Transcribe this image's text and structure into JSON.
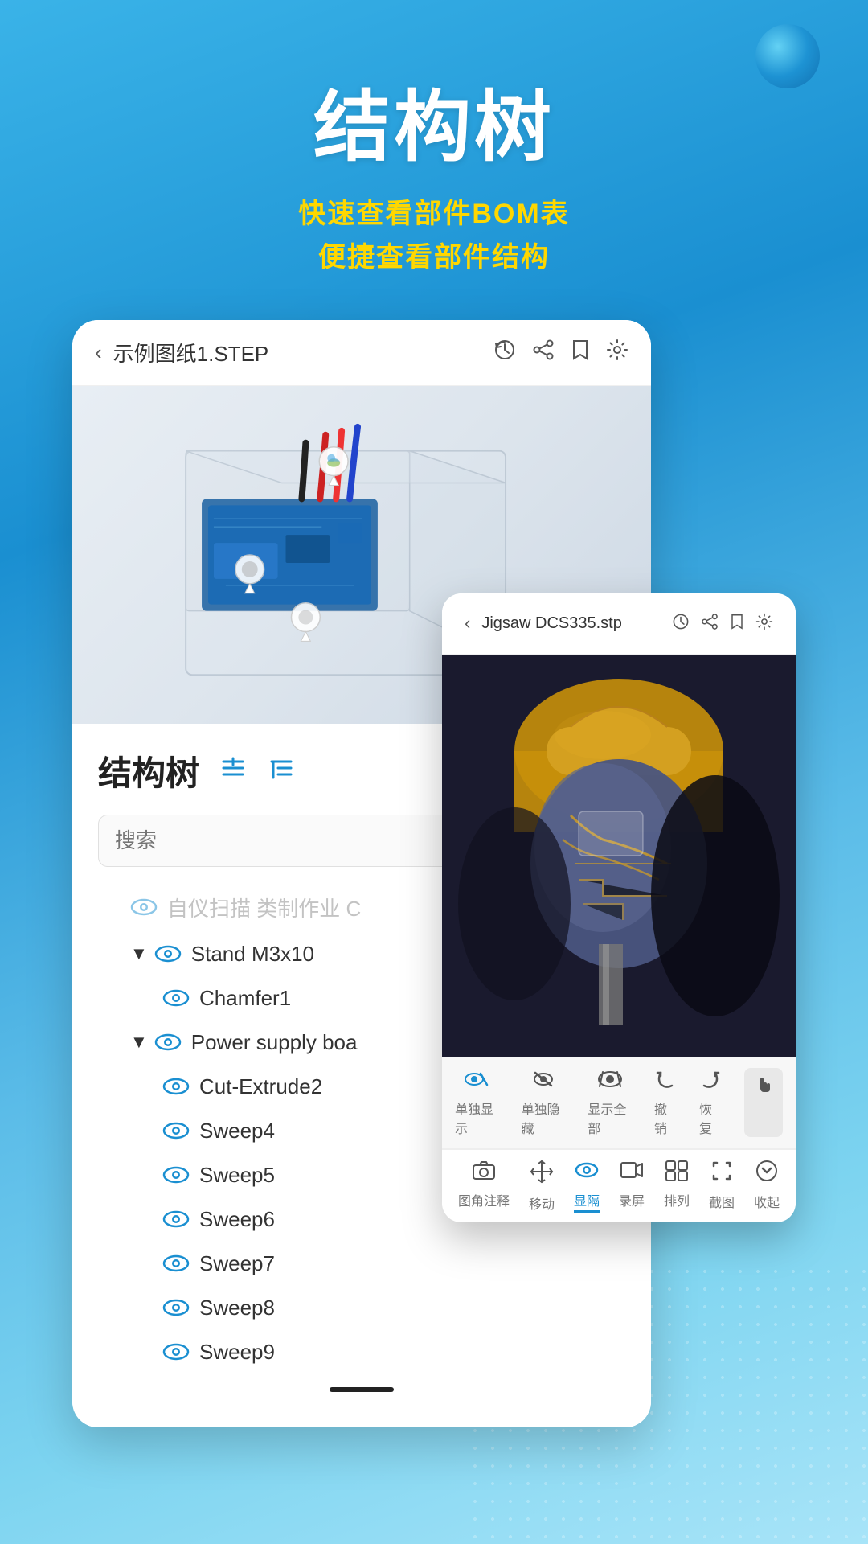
{
  "hero": {
    "title": "结构树",
    "subtitle_line1": "快速查看部件BOM表",
    "subtitle_line2": "便捷查看部件结构"
  },
  "card_primary": {
    "header": {
      "back_label": "‹",
      "file_title": "示例图纸1.STEP",
      "icon_history": "⏱",
      "icon_share": "⬆",
      "icon_bookmark": "🔖",
      "icon_settings": "⚙"
    },
    "panel": {
      "title": "结构树",
      "search_placeholder": "搜索",
      "tree_items": [
        {
          "indent": 1,
          "has_arrow": false,
          "faded": true,
          "label": "自仪扫描 类制作业 C"
        },
        {
          "indent": 1,
          "has_arrow": true,
          "faded": false,
          "label": "Stand M3x10"
        },
        {
          "indent": 2,
          "has_arrow": false,
          "faded": false,
          "label": "Chamfer1"
        },
        {
          "indent": 1,
          "has_arrow": true,
          "faded": false,
          "label": "Power supply  boa"
        },
        {
          "indent": 2,
          "has_arrow": false,
          "faded": false,
          "label": "Cut-Extrude2"
        },
        {
          "indent": 2,
          "has_arrow": false,
          "faded": false,
          "label": "Sweep4"
        },
        {
          "indent": 2,
          "has_arrow": false,
          "faded": false,
          "label": "Sweep5"
        },
        {
          "indent": 2,
          "has_arrow": false,
          "faded": false,
          "label": "Sweep6"
        },
        {
          "indent": 2,
          "has_arrow": false,
          "faded": false,
          "label": "Sweep7"
        },
        {
          "indent": 2,
          "has_arrow": false,
          "faded": false,
          "label": "Sweep8"
        },
        {
          "indent": 2,
          "has_arrow": false,
          "faded": false,
          "label": "Sweep9"
        }
      ]
    }
  },
  "card_secondary": {
    "header": {
      "back_label": "‹",
      "file_title": "Jigsaw DCS335.stp",
      "icon_history": "⏱",
      "icon_share": "⬆",
      "icon_bookmark": "🔖",
      "icon_settings": "⚙"
    },
    "toolbar_top": [
      {
        "icon": "✦",
        "label": "单独显示"
      },
      {
        "icon": "✦",
        "label": "单独隐藏"
      },
      {
        "icon": "✦",
        "label": "显示全部"
      },
      {
        "icon": "↺",
        "label": "撤销"
      },
      {
        "icon": "↻",
        "label": "恢复"
      },
      {
        "icon": "✋",
        "label": ""
      }
    ],
    "toolbar_bottom": [
      {
        "icon": "📷",
        "label": "图角注释"
      },
      {
        "icon": "↔",
        "label": "移动"
      },
      {
        "icon": "👁",
        "label": "显隔",
        "active": true
      },
      {
        "icon": "🎬",
        "label": "录屏"
      },
      {
        "icon": "✦",
        "label": "排列"
      },
      {
        "icon": "✂",
        "label": "截图"
      },
      {
        "icon": "⊕",
        "label": "收起"
      }
    ]
  },
  "colors": {
    "primary_blue": "#1a8fd1",
    "accent_yellow": "#ffd700",
    "eye_blue": "#1a8fd1",
    "text_dark": "#222222",
    "text_mid": "#555555",
    "bg_gradient_start": "#3ab3e8",
    "bg_gradient_end": "#7dd4f0"
  }
}
